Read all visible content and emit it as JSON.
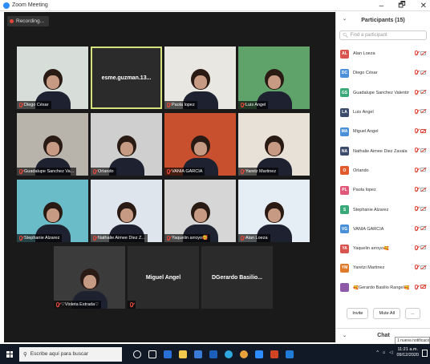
{
  "window": {
    "title": "Zoom Meeting",
    "controls": [
      "–",
      "🗗",
      "✕"
    ]
  },
  "recording": {
    "label": "Recording..."
  },
  "tiles": [
    {
      "name": "Diego César",
      "muted": true,
      "video": true,
      "bg": "#d7ddd9"
    },
    {
      "name": "esme.guzman.13...",
      "muted": false,
      "video": false,
      "active": true
    },
    {
      "name": "Paola lopez",
      "muted": true,
      "video": true,
      "bg": "#e9e7e2"
    },
    {
      "name": "Luis Angel",
      "muted": true,
      "video": true,
      "bg": "#5fa36a"
    },
    {
      "name": "Guadalupe Sanchez Va...",
      "muted": true,
      "video": true,
      "bg": "#b8b3ab"
    },
    {
      "name": "Orlando",
      "muted": true,
      "video": true,
      "bg": "#cfcfcf"
    },
    {
      "name": "VANIA GARCIA",
      "muted": true,
      "video": true,
      "bg": "#c8502e"
    },
    {
      "name": "Yaretz Martinez",
      "muted": true,
      "video": true,
      "bg": "#e7e1d8"
    },
    {
      "name": "Stephanie Alzarez",
      "muted": true,
      "video": true,
      "bg": "#6bbcc9"
    },
    {
      "name": "Nathalie Aimee Diez Z...",
      "muted": true,
      "video": true,
      "bg": "#dfe5ec"
    },
    {
      "name": "Yaquelin arroyo🥰",
      "muted": true,
      "video": true,
      "bg": "#d6d6d6"
    },
    {
      "name": "Alan Loeza",
      "muted": true,
      "video": true,
      "bg": "#e6eef5"
    },
    {
      "name": "♡Violeta Estrada♡",
      "muted": true,
      "video": true,
      "bg": "#3b3b3b"
    },
    {
      "name": "Miguel Angel",
      "muted": true,
      "video": false
    },
    {
      "name": "DGerardo Basilio...",
      "muted": false,
      "video": false
    }
  ],
  "participants": {
    "title": "Participants (15)",
    "search_placeholder": "Find a participant",
    "items": [
      {
        "initials": "AL",
        "name": "Alan Loeza",
        "color": "#d9534f",
        "cam_red": false
      },
      {
        "initials": "DC",
        "name": "Diego César",
        "color": "#4a90d9",
        "cam_red": false
      },
      {
        "initials": "GS",
        "name": "Guadalupe Sanchez Valentin",
        "color": "#3aa879",
        "cam_red": false
      },
      {
        "initials": "LA",
        "name": "Luis Ángel",
        "color": "#3b4a6b",
        "cam_red": false
      },
      {
        "initials": "MA",
        "name": "Miguel Angel",
        "color": "#4a90d9",
        "cam_red": true
      },
      {
        "initials": "NA",
        "name": "Nathalie Aimee Diez Zavala",
        "color": "#3b4a6b",
        "cam_red": false
      },
      {
        "initials": "O",
        "name": "Orlando",
        "color": "#e05a2b",
        "cam_red": false
      },
      {
        "initials": "PL",
        "name": "Paola lopez",
        "color": "#e0587a",
        "cam_red": false
      },
      {
        "initials": "S",
        "name": "Stephanie Alzarez",
        "color": "#3aa879",
        "cam_red": false
      },
      {
        "initials": "VG",
        "name": "VANIA GARCIA",
        "color": "#4a90d9",
        "cam_red": false
      },
      {
        "initials": "YA",
        "name": "Yaquelin arroyo🥰",
        "color": "#d9534f",
        "cam_red": false
      },
      {
        "initials": "YM",
        "name": "Yaretzi Martinez",
        "color": "#e07a2b",
        "cam_red": false
      },
      {
        "initials": "",
        "name": "🥰Gerardo Basilio Rangel🥰",
        "color": "#8e5aa8",
        "cam_red": true
      }
    ],
    "invite_label": "Invite",
    "mute_all_label": "Mute All",
    "more_label": "..."
  },
  "chat": {
    "label": "Chat"
  },
  "tooltip": {
    "label": "1 nueva notificación"
  },
  "taskbar": {
    "search_placeholder": "Escribe aquí para buscar",
    "time": "11:21 a.m.",
    "date": "09/12/2020"
  }
}
